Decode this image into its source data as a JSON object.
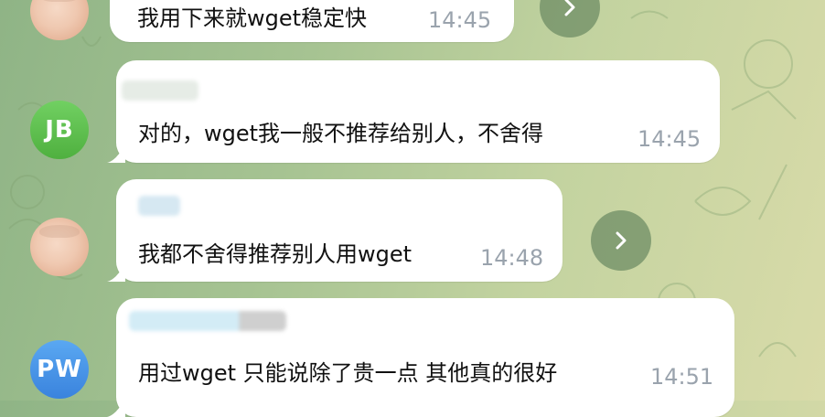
{
  "colors": {
    "bubble": "#ffffff",
    "time": "#9aa3ad",
    "jb_avatar": "#5cbf4b",
    "pw_avatar": "#3f8de6",
    "forward_button": "#6e8c64"
  },
  "messages": [
    {
      "text": "我用下来就wget稳定快",
      "time": "14:45",
      "avatar_icon": "user-photo-avatar"
    },
    {
      "avatar_initials": "JB",
      "text": "对的，wget我一般不推荐给别人，不舍得",
      "time": "14:45"
    },
    {
      "text": "我都不舍得推荐别人用wget",
      "time": "14:48",
      "avatar_icon": "user-photo-avatar"
    },
    {
      "avatar_initials": "PW",
      "text": "用过wget 只能说除了贵一点 其他真的很好",
      "time": "14:51"
    }
  ],
  "forward_icon": "chevron-right-icon"
}
